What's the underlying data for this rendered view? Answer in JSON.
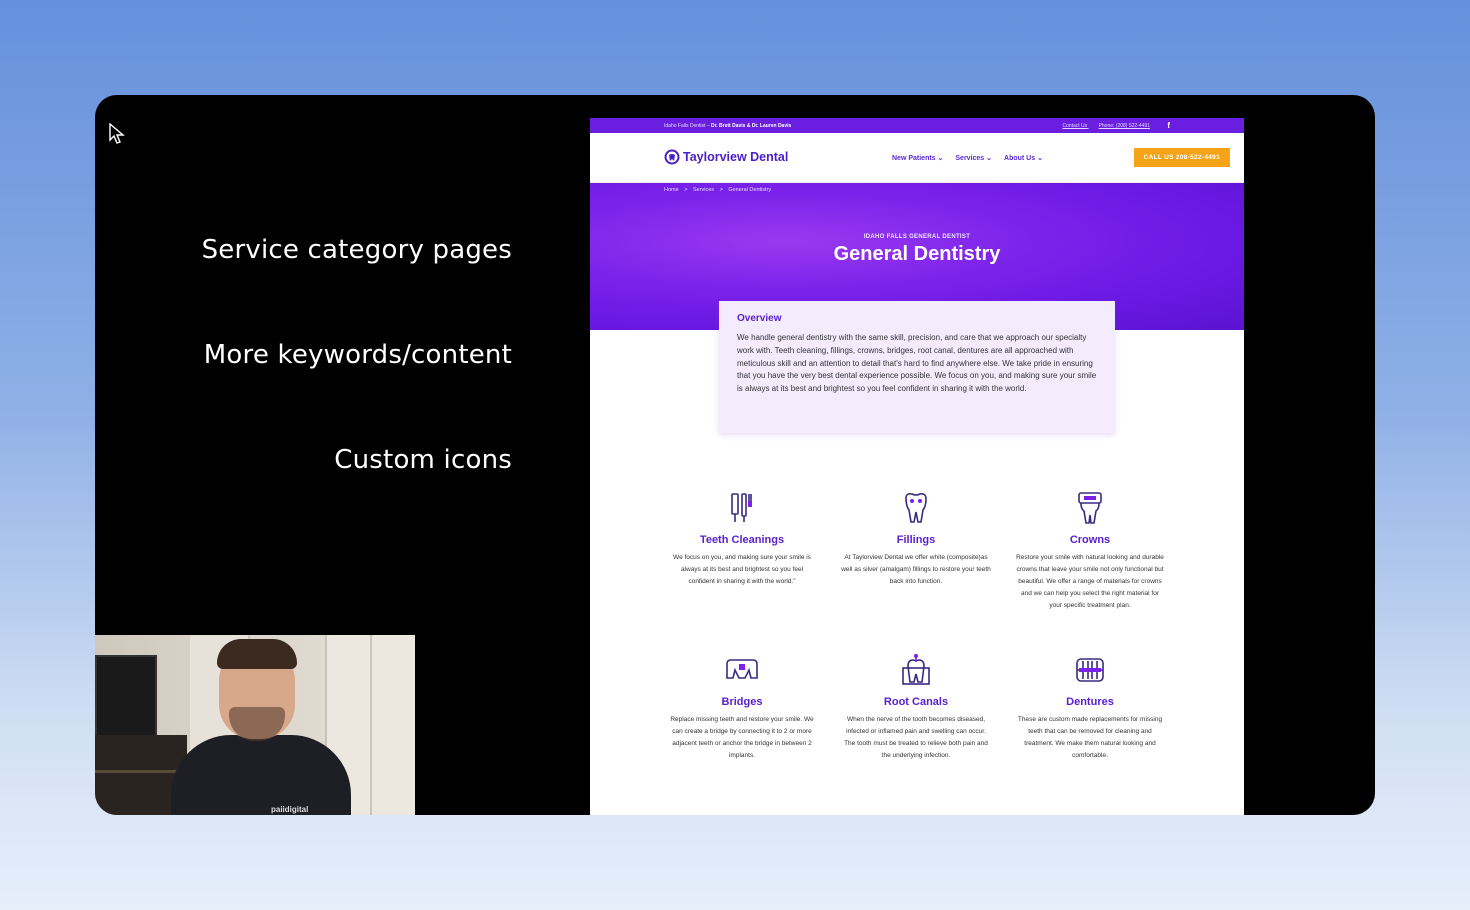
{
  "slide": {
    "bullets": [
      "Service category pages",
      "More keywords/content",
      "Custom icons"
    ]
  },
  "webcam": {
    "shirt_logo": "paiidigital"
  },
  "site": {
    "topbar": {
      "location": "Idaho Falls Dentist –",
      "doctors": "Dr. Brett Davis & Dr. Lauren Davis",
      "contact": "Contact Us",
      "phone": "Phone: (208) 522-4491",
      "social_icon": "facebook-icon"
    },
    "header": {
      "logo": "Taylorview Dental",
      "nav": [
        "New Patients",
        "Services",
        "About Us"
      ],
      "cta": "CALL US 208-522-4491"
    },
    "breadcrumbs": [
      "Home",
      ">",
      "Services",
      ">",
      "General Dentistry"
    ],
    "hero": {
      "eyebrow": "IDAHO FALLS GENERAL DENTIST",
      "title": "General Dentistry"
    },
    "overview": {
      "heading": "Overview",
      "body": "We handle general dentistry with the same skill, precision, and care that we approach our specialty work with. Teeth cleaning, fillings, crowns, bridges, root canal, dentures are all approached with meticulous skill and an attention to detail that's hard to find anywhere else. We take pride in ensuring that you have the very best dental experience possible. We focus on you, and making sure your smile is always at its best and brightest so you feel confident in sharing it with the world."
    },
    "services": [
      {
        "icon": "toothbrush-icon",
        "title": "Teeth Cleanings",
        "text": "We focus on you, and making sure your smile is always at its best and brightest so you feel confident in sharing it with the world.\""
      },
      {
        "icon": "tooth-filling-icon",
        "title": "Fillings",
        "text": "At Taylorview Dental we offer white (composite)as well as silver (amalgam) fillings to restore your teeth back into function."
      },
      {
        "icon": "crown-icon",
        "title": "Crowns",
        "text": "Restore your smile with natural looking and durable crowns that leave your smile not only functional but beautiful. We offer a range of materials for crowns and we can help you select the right material for your specific treatment plan."
      },
      {
        "icon": "bridge-icon",
        "title": "Bridges",
        "text": "Replace missing teeth and restore your smile. We can create a bridge by connecting it to 2 or more adjacent teeth or anchor the bridge in between 2 implants."
      },
      {
        "icon": "root-canal-icon",
        "title": "Root Canals",
        "text": "When the nerve of the tooth becomes diseased, infected or inflamed pain and swelling can occur. The tooth must be treated to relieve both pain and the underlying infection."
      },
      {
        "icon": "dentures-icon",
        "title": "Dentures",
        "text": "These are custom made replacements for missing teeth that can be removed for cleaning and treatment. We make them natural looking and comfortable."
      }
    ]
  }
}
